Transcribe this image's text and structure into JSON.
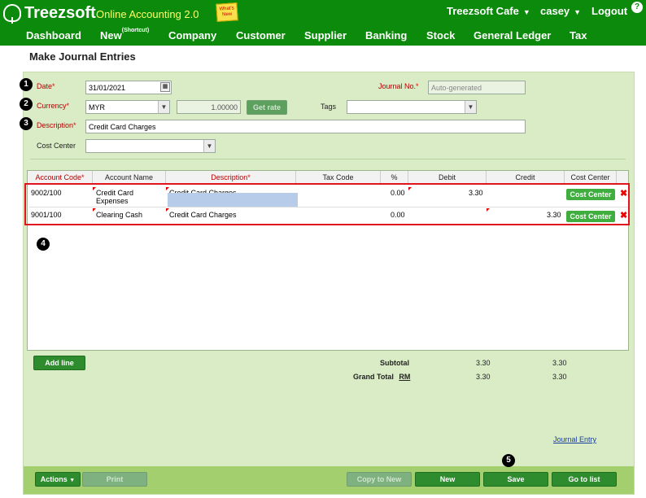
{
  "header": {
    "logo": "Treezsoft",
    "product": "Online Accounting 2.0",
    "whats_new": "What's New",
    "company": "Treezsoft Cafe",
    "user": "casey",
    "logout": "Logout",
    "help_icon": "help-icon"
  },
  "nav": {
    "items": [
      "Dashboard",
      "New",
      "Company",
      "Customer",
      "Supplier",
      "Banking",
      "Stock",
      "General Ledger",
      "Tax"
    ],
    "new_sup": "(Shortcut)"
  },
  "page": {
    "title": "Make Journal Entries"
  },
  "form": {
    "date_label": "Date",
    "date_value": "31/01/2021",
    "currency_label": "Currency",
    "currency_value": "MYR",
    "rate_value": "1.00000",
    "get_rate": "Get rate",
    "tags_label": "Tags",
    "tags_value": "",
    "description_label": "Description",
    "description_value": "Credit Card Charges",
    "cost_center_label": "Cost Center",
    "cost_center_value": "",
    "journal_no_label": "Journal No.",
    "journal_no_value": "Auto-generated",
    "required_mark": "*"
  },
  "grid": {
    "headers": [
      "Account Code",
      "Account Name",
      "Description",
      "Tax Code",
      "%",
      "Debit",
      "Credit",
      "Cost Center"
    ],
    "rows": [
      {
        "code": "9002/100",
        "name": "Credit Card Expenses",
        "description": "Credit Card Charges",
        "tax": "",
        "pct": "0.00",
        "debit": "3.30",
        "credit": "",
        "cost_center": "Cost Center"
      },
      {
        "code": "9001/100",
        "name": "Clearing Cash",
        "description": "Credit Card Charges",
        "tax": "",
        "pct": "0.00",
        "debit": "",
        "credit": "3.30",
        "cost_center": "Cost Center"
      }
    ]
  },
  "totals": {
    "add_line": "Add line",
    "subtotal_label": "Subtotal",
    "subtotal_debit": "3.30",
    "subtotal_credit": "3.30",
    "grand_total_label": "Grand Total",
    "currency": "RM",
    "grand_debit": "3.30",
    "grand_credit": "3.30"
  },
  "journal_link": "Journal Entry",
  "footer": {
    "actions": "Actions",
    "print": "Print",
    "copy_to_new": "Copy to New",
    "new": "New",
    "save": "Save",
    "go_to_list": "Go to list"
  },
  "badges": [
    "1",
    "2",
    "3",
    "4",
    "5"
  ],
  "colors": {
    "topbar": "#0c8a0c",
    "panel": "#d9ecc6",
    "button": "#2e8b2e",
    "highlight": "#e0141e"
  }
}
